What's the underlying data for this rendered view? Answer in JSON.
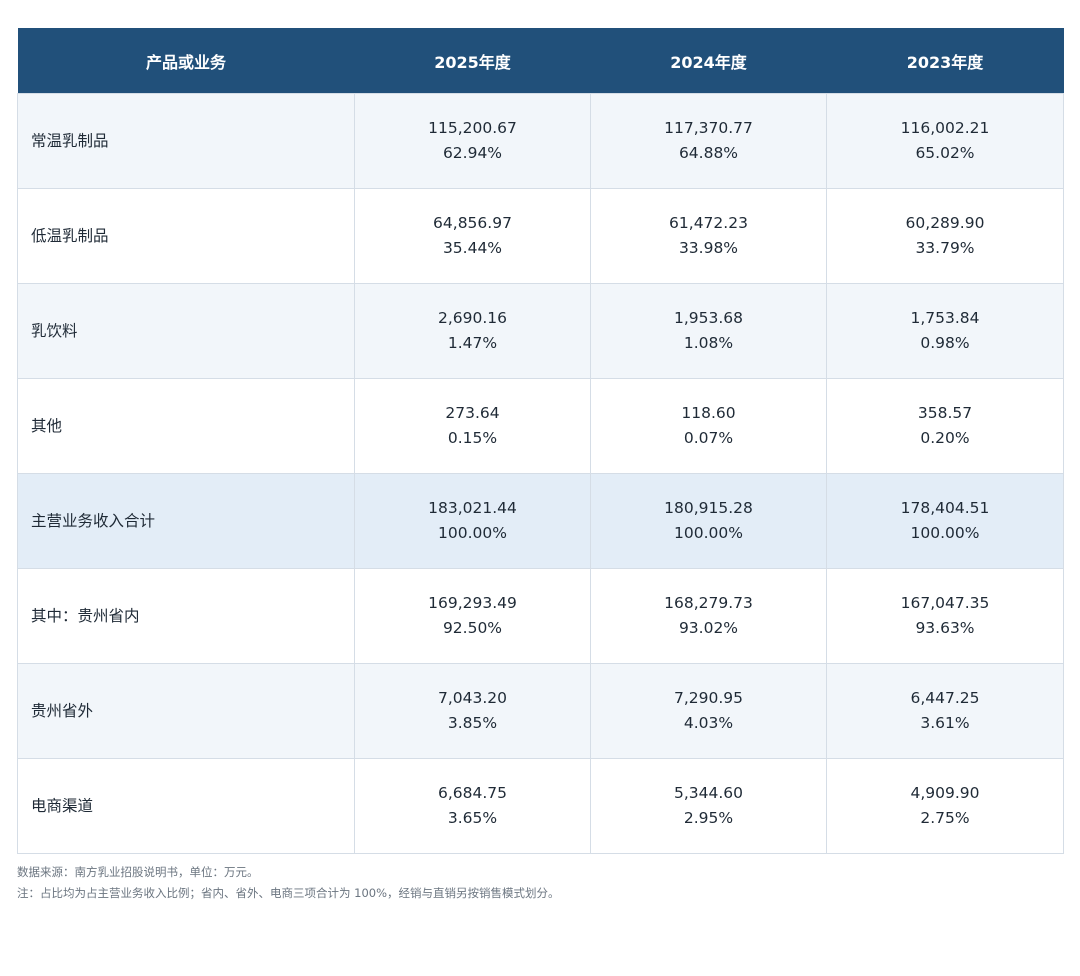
{
  "table": {
    "headers": [
      "产品或业务",
      "2025年度",
      "2024年度",
      "2023年度"
    ],
    "rows": [
      {
        "label": "常温乳制品",
        "cells": [
          [
            "115,200.67",
            "62.94%"
          ],
          [
            "117,370.77",
            "64.88%"
          ],
          [
            "116,002.21",
            "65.02%"
          ]
        ]
      },
      {
        "label": "低温乳制品",
        "cells": [
          [
            "64,856.97",
            "35.44%"
          ],
          [
            "61,472.23",
            "33.98%"
          ],
          [
            "60,289.90",
            "33.79%"
          ]
        ]
      },
      {
        "label": "乳饮料",
        "cells": [
          [
            "2,690.16",
            "1.47%"
          ],
          [
            "1,953.68",
            "1.08%"
          ],
          [
            "1,753.84",
            "0.98%"
          ]
        ]
      },
      {
        "label": "其他",
        "cells": [
          [
            "273.64",
            "0.15%"
          ],
          [
            "118.60",
            "0.07%"
          ],
          [
            "358.57",
            "0.20%"
          ]
        ]
      },
      {
        "label": "主营业务收入合计",
        "cells": [
          [
            "183,021.44",
            "100.00%"
          ],
          [
            "180,915.28",
            "100.00%"
          ],
          [
            "178,404.51",
            "100.00%"
          ]
        ]
      },
      {
        "label": "其中：贵州省内",
        "cells": [
          [
            "169,293.49",
            "92.50%"
          ],
          [
            "168,279.73",
            "93.02%"
          ],
          [
            "167,047.35",
            "93.63%"
          ]
        ]
      },
      {
        "label": "贵州省外",
        "cells": [
          [
            "7,043.20",
            "3.85%"
          ],
          [
            "7,290.95",
            "4.03%"
          ],
          [
            "6,447.25",
            "3.61%"
          ]
        ]
      },
      {
        "label": "电商渠道",
        "cells": [
          [
            "6,684.75",
            "3.65%"
          ],
          [
            "5,344.60",
            "2.95%"
          ],
          [
            "4,909.90",
            "2.75%"
          ]
        ]
      }
    ]
  },
  "notes": {
    "source": "数据来源：南方乳业招股说明书，单位：万元。",
    "note": "注：占比均为占主营业务收入比例；省内、省外、电商三项合计为 100%，经销与直销另按销售模式划分。"
  },
  "colors": {
    "header_bg": "#21507a",
    "row_alt_bg": "#f2f6fa",
    "total_bg": "#e3edf7",
    "border": "#d5dde6"
  }
}
